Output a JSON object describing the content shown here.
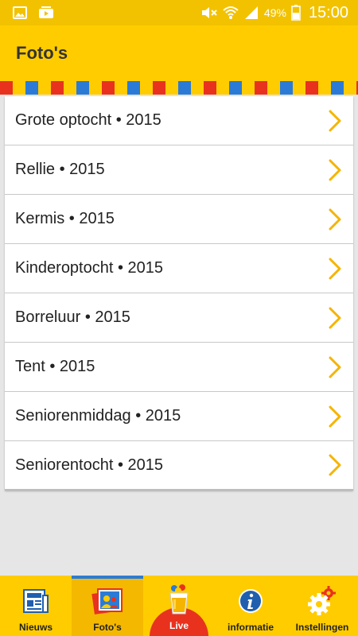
{
  "status_bar": {
    "battery_percent": "49%",
    "time": "15:00",
    "icons": [
      "gallery-icon",
      "youtube-icon",
      "mute-icon",
      "wifi-icon",
      "signal-icon",
      "battery-icon"
    ]
  },
  "app_bar": {
    "title": "Foto's"
  },
  "flag_colors": [
    "#e8321e",
    "#ffcc00",
    "#2b7bd6",
    "#ffcc00"
  ],
  "list": {
    "items": [
      {
        "label": "Grote optocht • 2015"
      },
      {
        "label": "Rellie • 2015"
      },
      {
        "label": "Kermis • 2015"
      },
      {
        "label": "Kinderoptocht • 2015"
      },
      {
        "label": "Borreluur • 2015"
      },
      {
        "label": "Tent • 2015"
      },
      {
        "label": "Seniorenmiddag • 2015"
      },
      {
        "label": "Seniorentocht • 2015"
      }
    ]
  },
  "bottom_nav": {
    "tabs": [
      {
        "label": "Nieuws",
        "icon": "newspaper-icon"
      },
      {
        "label": "Foto's",
        "icon": "photos-icon",
        "active": true
      },
      {
        "label": "Live",
        "icon": "beer-icon"
      },
      {
        "label": "informatie",
        "icon": "info-icon"
      },
      {
        "label": "Instellingen",
        "icon": "settings-icon"
      }
    ]
  },
  "colors": {
    "status_bar": "#f2c200",
    "app_bar": "#ffcc00",
    "accent_blue": "#2b7bd6",
    "accent_red": "#e8321e",
    "chevron": "#f5b400"
  }
}
